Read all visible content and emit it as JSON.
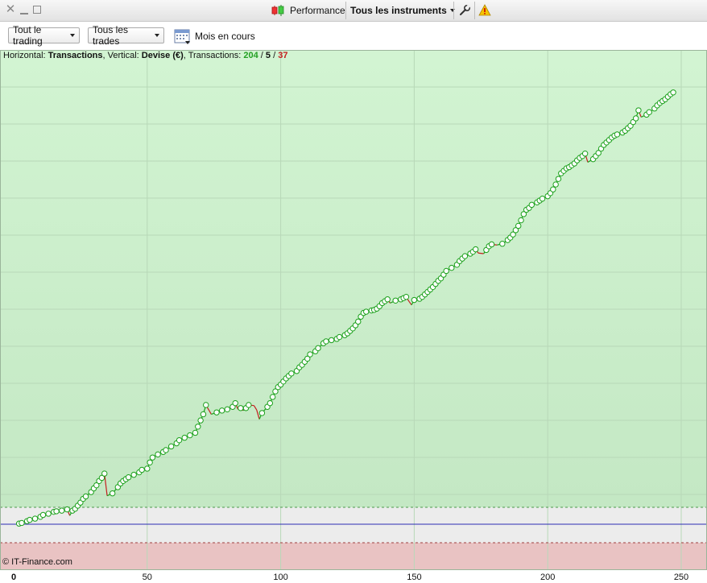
{
  "titlebar": {
    "performance_label": "Performance",
    "instruments_label": "Tous les instruments"
  },
  "toolbar": {
    "trading_filter": "Tout le trading",
    "trades_filter": "Tous les trades",
    "period_label": "Mois en cours"
  },
  "info": {
    "h_prefix": "Horizontal: ",
    "h_value": "Transactions",
    "v_prefix": ", Vertical: ",
    "v_value": "Devise (€)",
    "t_prefix": ", Transactions: ",
    "wins": "204",
    "slash1": " / ",
    "neutral": "5",
    "slash2": " / ",
    "losses": "37"
  },
  "copyright": "© IT-Finance.com",
  "colors": {
    "profit_zone": "#cdf0cd",
    "loss_zone": "#e9c3c3",
    "neutral_zone": "#ececec",
    "line_up": "#1aa01a",
    "line_down": "#c41e1e",
    "zero_line": "#2b2bb5",
    "wins": "#22a022",
    "losses": "#c41e1e"
  },
  "chart_data": {
    "type": "line",
    "xlabel": "",
    "ylabel": "",
    "xlim": [
      0,
      260
    ],
    "x_ticks": [
      0,
      50,
      100,
      150,
      200,
      250
    ],
    "points": [
      [
        2,
        1
      ],
      [
        3,
        2
      ],
      [
        5,
        5
      ],
      [
        6,
        7
      ],
      [
        8,
        9
      ],
      [
        10,
        12
      ],
      [
        11,
        15
      ],
      [
        13,
        17
      ],
      [
        15,
        20
      ],
      [
        16,
        21
      ],
      [
        18,
        22
      ],
      [
        20,
        24
      ],
      [
        21,
        14
      ],
      [
        22,
        22
      ],
      [
        23,
        25
      ],
      [
        24,
        30
      ],
      [
        25,
        35
      ],
      [
        26,
        41
      ],
      [
        27,
        45
      ],
      [
        29,
        52
      ],
      [
        30,
        58
      ],
      [
        31,
        63
      ],
      [
        32,
        70
      ],
      [
        33,
        75
      ],
      [
        34,
        82
      ],
      [
        35,
        46
      ],
      [
        37,
        50
      ],
      [
        39,
        60
      ],
      [
        40,
        66
      ],
      [
        41,
        70
      ],
      [
        42,
        73
      ],
      [
        43,
        76
      ],
      [
        45,
        80
      ],
      [
        47,
        84
      ],
      [
        48,
        88
      ],
      [
        50,
        90
      ],
      [
        51,
        100
      ],
      [
        52,
        108
      ],
      [
        54,
        113
      ],
      [
        56,
        117
      ],
      [
        57,
        120
      ],
      [
        59,
        126
      ],
      [
        61,
        131
      ],
      [
        62,
        136
      ],
      [
        64,
        140
      ],
      [
        66,
        144
      ],
      [
        68,
        148
      ],
      [
        69,
        158
      ],
      [
        70,
        168
      ],
      [
        71,
        178
      ],
      [
        72,
        193
      ],
      [
        74,
        178
      ],
      [
        76,
        181
      ],
      [
        78,
        184
      ],
      [
        80,
        186
      ],
      [
        82,
        190
      ],
      [
        83,
        196
      ],
      [
        84,
        186
      ],
      [
        85,
        188
      ],
      [
        86,
        184
      ],
      [
        87,
        188
      ],
      [
        88,
        193
      ],
      [
        90,
        192
      ],
      [
        91,
        185
      ],
      [
        92,
        170
      ],
      [
        93,
        180
      ],
      [
        95,
        190
      ],
      [
        96,
        196
      ],
      [
        97,
        206
      ],
      [
        98,
        215
      ],
      [
        99,
        222
      ],
      [
        100,
        226
      ],
      [
        101,
        231
      ],
      [
        102,
        236
      ],
      [
        103,
        240
      ],
      [
        104,
        244
      ],
      [
        106,
        248
      ],
      [
        107,
        254
      ],
      [
        108,
        258
      ],
      [
        109,
        263
      ],
      [
        110,
        268
      ],
      [
        111,
        275
      ],
      [
        113,
        280
      ],
      [
        114,
        285
      ],
      [
        116,
        293
      ],
      [
        117,
        296
      ],
      [
        119,
        298
      ],
      [
        121,
        300
      ],
      [
        122,
        303
      ],
      [
        124,
        306
      ],
      [
        125,
        309
      ],
      [
        126,
        313
      ],
      [
        127,
        317
      ],
      [
        128,
        322
      ],
      [
        129,
        328
      ],
      [
        130,
        336
      ],
      [
        131,
        342
      ],
      [
        132,
        344
      ],
      [
        134,
        346
      ],
      [
        135,
        347
      ],
      [
        136,
        349
      ],
      [
        137,
        353
      ],
      [
        138,
        358
      ],
      [
        139,
        361
      ],
      [
        140,
        364
      ],
      [
        141,
        358
      ],
      [
        143,
        362
      ],
      [
        145,
        364
      ],
      [
        146,
        366
      ],
      [
        147,
        368
      ],
      [
        148,
        361
      ],
      [
        149,
        355
      ],
      [
        150,
        363
      ],
      [
        152,
        365
      ],
      [
        153,
        368
      ],
      [
        154,
        372
      ],
      [
        155,
        376
      ],
      [
        156,
        380
      ],
      [
        157,
        384
      ],
      [
        158,
        389
      ],
      [
        159,
        394
      ],
      [
        160,
        398
      ],
      [
        161,
        404
      ],
      [
        162,
        410
      ],
      [
        164,
        415
      ],
      [
        166,
        420
      ],
      [
        167,
        426
      ],
      [
        168,
        430
      ],
      [
        169,
        434
      ],
      [
        171,
        438
      ],
      [
        172,
        441
      ],
      [
        173,
        445
      ],
      [
        174,
        439
      ],
      [
        176,
        438
      ],
      [
        177,
        444
      ],
      [
        178,
        450
      ],
      [
        179,
        453
      ],
      [
        181,
        452
      ],
      [
        183,
        454
      ],
      [
        185,
        460
      ],
      [
        186,
        464
      ],
      [
        187,
        469
      ],
      [
        188,
        476
      ],
      [
        189,
        483
      ],
      [
        190,
        492
      ],
      [
        191,
        502
      ],
      [
        192,
        509
      ],
      [
        193,
        512
      ],
      [
        194,
        517
      ],
      [
        196,
        521
      ],
      [
        197,
        524
      ],
      [
        198,
        527
      ],
      [
        200,
        531
      ],
      [
        201,
        536
      ],
      [
        202,
        542
      ],
      [
        203,
        550
      ],
      [
        204,
        559
      ],
      [
        205,
        568
      ],
      [
        206,
        572
      ],
      [
        207,
        576
      ],
      [
        208,
        578
      ],
      [
        209,
        581
      ],
      [
        210,
        584
      ],
      [
        211,
        589
      ],
      [
        212,
        593
      ],
      [
        213,
        596
      ],
      [
        214,
        600
      ],
      [
        215,
        586
      ],
      [
        217,
        591
      ],
      [
        218,
        596
      ],
      [
        219,
        601
      ],
      [
        220,
        608
      ],
      [
        221,
        614
      ],
      [
        222,
        618
      ],
      [
        223,
        622
      ],
      [
        224,
        626
      ],
      [
        225,
        629
      ],
      [
        226,
        631
      ],
      [
        228,
        634
      ],
      [
        229,
        637
      ],
      [
        230,
        641
      ],
      [
        231,
        645
      ],
      [
        232,
        651
      ],
      [
        233,
        657
      ],
      [
        234,
        670
      ],
      [
        235,
        659
      ],
      [
        237,
        663
      ],
      [
        238,
        667
      ],
      [
        240,
        673
      ],
      [
        241,
        678
      ],
      [
        242,
        682
      ],
      [
        243,
        685
      ],
      [
        244,
        688
      ],
      [
        245,
        692
      ],
      [
        246,
        696
      ],
      [
        247,
        699
      ]
    ]
  }
}
